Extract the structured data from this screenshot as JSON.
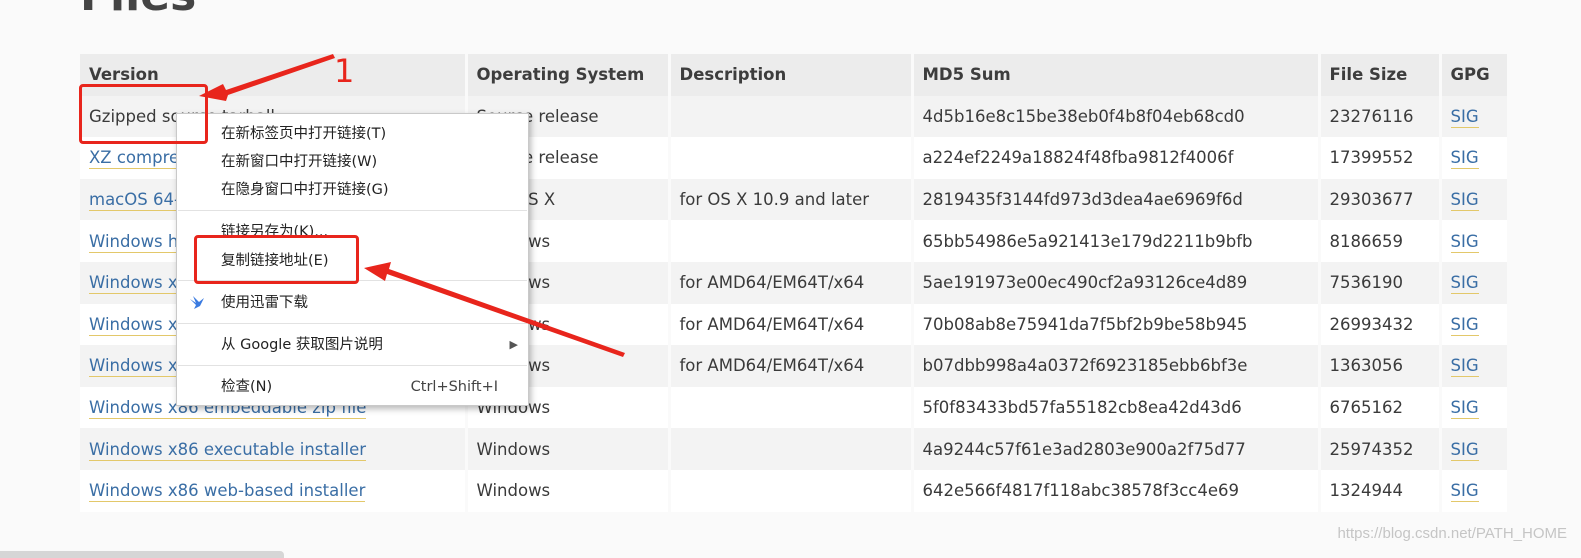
{
  "page": {
    "title": "Files"
  },
  "table": {
    "headers": [
      "Version",
      "Operating System",
      "Description",
      "MD5 Sum",
      "File Size",
      "GPG"
    ],
    "rows": [
      {
        "version": "Gzipped source tarball",
        "os": "Source release",
        "description": "",
        "md5": "4d5b16e8c15be38eb0f4b8f04eb68cd0",
        "size": "23276116",
        "gpg": "SIG"
      },
      {
        "version": "XZ compressed source tarball",
        "os": "Source release",
        "description": "",
        "md5": "a224ef2249a18824f48fba9812f4006f",
        "size": "17399552",
        "gpg": "SIG"
      },
      {
        "version": "macOS 64-bit installer",
        "os": "Mac OS X",
        "description": "for OS X 10.9 and later",
        "md5": "2819435f3144fd973d3dea4ae6969f6d",
        "size": "29303677",
        "gpg": "SIG"
      },
      {
        "version": "Windows help file",
        "os": "Windows",
        "description": "",
        "md5": "65bb54986e5a921413e179d2211b9bfb",
        "size": "8186659",
        "gpg": "SIG"
      },
      {
        "version": "Windows x86-64 embeddable zip file",
        "os": "Windows",
        "description": "for AMD64/EM64T/x64",
        "md5": "5ae191973e00ec490cf2a93126ce4d89",
        "size": "7536190",
        "gpg": "SIG"
      },
      {
        "version": "Windows x86-64 executable installer",
        "os": "Windows",
        "description": "for AMD64/EM64T/x64",
        "md5": "70b08ab8e75941da7f5bf2b9be58b945",
        "size": "26993432",
        "gpg": "SIG"
      },
      {
        "version": "Windows x86-64 web-based installer",
        "os": "Windows",
        "description": "for AMD64/EM64T/x64",
        "md5": "b07dbb998a4a0372f6923185ebb6bf3e",
        "size": "1363056",
        "gpg": "SIG"
      },
      {
        "version": "Windows x86 embeddable zip file",
        "os": "Windows",
        "description": "",
        "md5": "5f0f83433bd57fa55182cb8ea42d43d6",
        "size": "6765162",
        "gpg": "SIG"
      },
      {
        "version": "Windows x86 executable installer",
        "os": "Windows",
        "description": "",
        "md5": "4a9244c57f61e3ad2803e900a2f75d77",
        "size": "25974352",
        "gpg": "SIG"
      },
      {
        "version": "Windows x86 web-based installer",
        "os": "Windows",
        "description": "",
        "md5": "642e566f4817f118abc38578f3cc4e69",
        "size": "1324944",
        "gpg": "SIG"
      }
    ]
  },
  "context_menu": {
    "open_new_tab": "在新标签页中打开链接(T)",
    "open_new_window": "在新窗口中打开链接(W)",
    "open_incognito": "在隐身窗口中打开链接(G)",
    "save_link_as": "链接另存为(K)...",
    "copy_link_address": "复制链接地址(E)",
    "xunlei_download": "使用迅雷下载",
    "xunlei_icon": "bird-icon",
    "google_image": "从 Google 获取图片说明",
    "inspect": "检查(N)",
    "inspect_shortcut": "Ctrl+Shift+I"
  },
  "annotations": {
    "step_number": "1",
    "color": "#e8251c"
  },
  "watermark": "https://blog.csdn.net/PATH_HOME"
}
